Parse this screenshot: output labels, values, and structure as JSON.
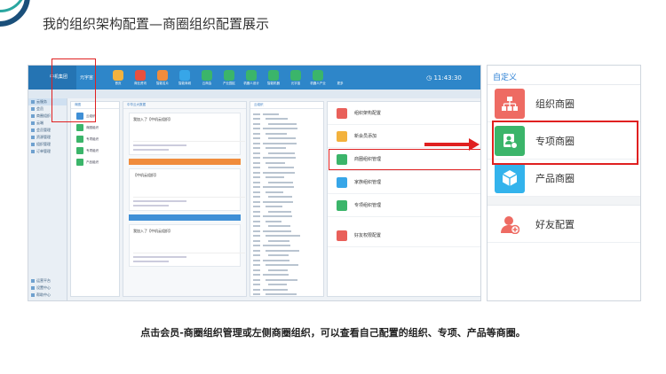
{
  "slide": {
    "title": "我的组织架构配置—商圈组织配置展示",
    "caption": "点击会员-商圈组织管理或左侧商圈组织，可以查看自己配置的组织、专项、产品等商圈。"
  },
  "app": {
    "brand": "中机集团",
    "brand_sub": "",
    "user": "元宇宙",
    "clock": "11:43:30",
    "apps": [
      {
        "label": "首页",
        "color": "#f3b23d"
      },
      {
        "label": "商业资讯",
        "color": "#e9503e"
      },
      {
        "label": "智能名片",
        "color": "#f08c3c"
      },
      {
        "label": "智能商城",
        "color": "#37a6e8"
      },
      {
        "label": "云商会",
        "color": "#3bb56a"
      },
      {
        "label": "产业园区",
        "color": "#3bb56a"
      },
      {
        "label": "机器人设计",
        "color": "#3bb56a"
      },
      {
        "label": "智能机器",
        "color": "#3bb56a"
      },
      {
        "label": "元宇宙",
        "color": "#3bb56a"
      },
      {
        "label": "机器人产业",
        "color": "#3bb56a"
      },
      {
        "label": "更多",
        "color": "#2e86c9"
      }
    ],
    "sidebar": [
      {
        "label": "云服务",
        "hl": true
      },
      {
        "label": "会员",
        "hl": false
      },
      {
        "label": "商圈组织",
        "hl": false
      },
      {
        "label": "云端",
        "hl": false
      },
      {
        "label": "会员管理",
        "hl": false
      },
      {
        "label": "资源管理",
        "hl": false
      },
      {
        "label": "组织管理",
        "hl": false
      },
      {
        "label": "订单管理",
        "hl": false
      }
    ],
    "sidebar_bottom": [
      {
        "label": "运营平台"
      },
      {
        "label": "设置中心"
      },
      {
        "label": "帮助中心"
      }
    ],
    "pane1": {
      "header": "商圈",
      "items": [
        {
          "label": "云组织",
          "color": "#3f8fd6"
        },
        {
          "label": "商圈组织",
          "color": "#3bb56a"
        },
        {
          "label": "专项组织",
          "color": "#3bb56a"
        },
        {
          "label": "专项组织",
          "color": "#3bb56a"
        },
        {
          "label": "产品组织",
          "color": "#3bb56a"
        }
      ]
    },
    "pane2": {
      "header": "中华云大数据",
      "cards": [
        "我加入了【中机云组织】",
        "【中机云组织】",
        "我加入了【中机云组织】"
      ]
    },
    "pane3": {
      "header": "云组织"
    },
    "menu": [
      {
        "label": "组织架构配置",
        "color": "#e9605a",
        "selected": false
      },
      {
        "label": "新会员添加",
        "color": "#f3b23d",
        "selected": false
      },
      {
        "label": "商圈组织管理",
        "color": "#3bb56a",
        "selected": true
      },
      {
        "label": "家族组织管理",
        "color": "#37a6e8",
        "selected": false
      },
      {
        "label": "专项组织管理",
        "color": "#3bb56a",
        "selected": false
      },
      {
        "label": "好友权限配置",
        "color": "#e9605a",
        "selected": false
      }
    ]
  },
  "zoom": {
    "header": "自定义",
    "items": [
      {
        "label": "组织商圈",
        "color": "#ee6b63",
        "icon": "org-chart-icon"
      },
      {
        "label": "专项商圈",
        "color": "#3bb56a",
        "icon": "member-card-icon"
      },
      {
        "label": "产品商圈",
        "color": "#33b3ec",
        "icon": "cube-icon"
      }
    ],
    "friend": {
      "label": "好友配置",
      "icon": "add-user-icon"
    }
  },
  "colors": {
    "accent": "#2e86c9",
    "highlight": "#e02020"
  }
}
